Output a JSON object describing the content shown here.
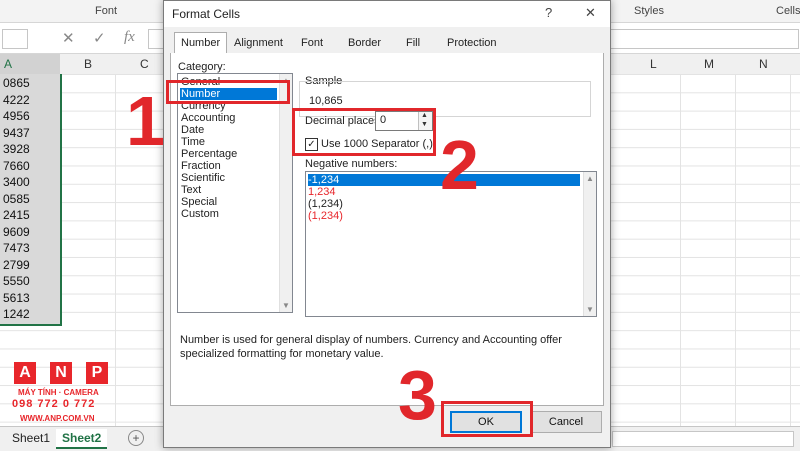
{
  "ribbon": {
    "groups": [
      "Font",
      "Styles",
      "Cells"
    ]
  },
  "formula_bar": {
    "cancel_icon": "x-icon",
    "enter_icon": "check-icon",
    "function_label": "fx"
  },
  "sheet": {
    "columns_left": [
      "A",
      "B",
      "C"
    ],
    "columns_right": [
      "L",
      "M",
      "N"
    ],
    "column_a_values": [
      "0865",
      "4222",
      "4956",
      "9437",
      "3928",
      "7660",
      "3400",
      "0585",
      "2415",
      "9609",
      "7473",
      "2799",
      "5550",
      "5613",
      "1242"
    ],
    "tabs": [
      "Sheet1",
      "Sheet2"
    ],
    "add_sheet_icon": "plus-icon"
  },
  "dialog": {
    "title": "Format Cells",
    "help": "?",
    "close": "✕",
    "tabs": [
      "Number",
      "Alignment",
      "Font",
      "Border",
      "Fill",
      "Protection"
    ],
    "category_label": "Category:",
    "categories": [
      "General",
      "Number",
      "Currency",
      "Accounting",
      "Date",
      "Time",
      "Percentage",
      "Fraction",
      "Scientific",
      "Text",
      "Special",
      "Custom"
    ],
    "selected_category": "Number",
    "sample_label": "Sample",
    "sample_value": "10,865",
    "decimal_label": "Decimal places:",
    "decimal_value": "0",
    "separator_label": "Use 1000 Separator (,)",
    "separator_checked": true,
    "negative_label": "Negative numbers:",
    "negative_options": [
      "-1,234",
      "1,234",
      "(1,234)",
      "(1,234)"
    ],
    "description": "Number is used for general display of numbers.  Currency and Accounting offer specialized formatting for monetary value.",
    "ok": "OK",
    "cancel": "Cancel"
  },
  "steps": [
    "1",
    "2",
    "3"
  ],
  "logo": {
    "letters": [
      "A",
      "N",
      "P"
    ],
    "tagline": "MÁY TÍNH · CAMERA",
    "phone": "098 772 0 772",
    "website": "WWW.ANP.COM.VN"
  },
  "colors": {
    "accent": "#0078d7",
    "highlight": "#e1272b",
    "excel_green": "#217346",
    "negative_red": "#e8262b"
  }
}
